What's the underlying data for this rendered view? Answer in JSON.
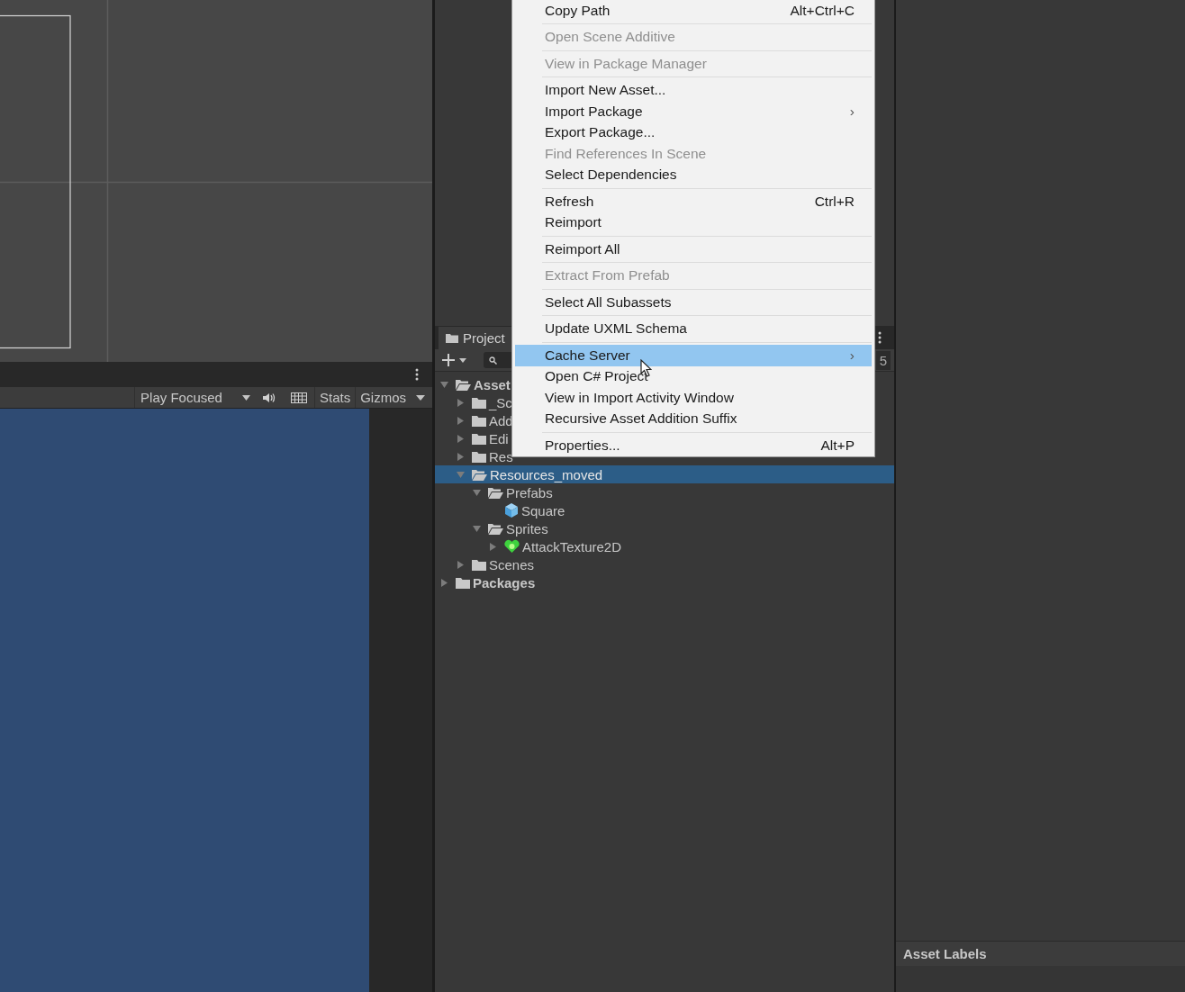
{
  "game_toolbar": {
    "play_mode": "Play Focused",
    "buttons": [
      {
        "label": "Stats"
      },
      {
        "label": "Gizmos"
      }
    ]
  },
  "project_panel": {
    "tab": "Project",
    "count": "5",
    "tree": [
      {
        "name": "Asset",
        "kind": "folder",
        "expanded": true,
        "selected": false,
        "children": [
          {
            "name": "_Sc",
            "kind": "folder",
            "expanded": false,
            "selected": false
          },
          {
            "name": "Add",
            "kind": "folder",
            "expanded": false,
            "selected": false
          },
          {
            "name": "Edi",
            "kind": "folder",
            "expanded": false,
            "selected": false
          },
          {
            "name": "Res",
            "kind": "folder",
            "expanded": false,
            "selected": false
          },
          {
            "name": "Resources_moved",
            "kind": "folder",
            "expanded": true,
            "selected": true,
            "children": [
              {
                "name": "Prefabs",
                "kind": "folder",
                "expanded": true,
                "selected": false,
                "children": [
                  {
                    "name": "Square",
                    "kind": "prefab",
                    "selected": false
                  }
                ]
              },
              {
                "name": "Sprites",
                "kind": "folder",
                "expanded": true,
                "selected": false,
                "children": [
                  {
                    "name": "AttackTexture2D",
                    "kind": "sprite",
                    "expanded": false,
                    "selected": false
                  }
                ]
              }
            ]
          },
          {
            "name": "Scenes",
            "kind": "folder",
            "expanded": false,
            "selected": false
          }
        ]
      },
      {
        "name": "Packages",
        "kind": "folder",
        "expanded": false,
        "selected": false
      }
    ]
  },
  "inspector": {
    "section": "Asset Labels"
  },
  "context_menu": {
    "groups": [
      [
        {
          "label": "Copy Path",
          "shortcut": "Alt+Ctrl+C",
          "disabled": false,
          "selected": false
        }
      ],
      [
        {
          "label": "Open Scene Additive",
          "disabled": true,
          "selected": false
        }
      ],
      [
        {
          "label": "View in Package Manager",
          "disabled": true,
          "selected": false
        }
      ],
      [
        {
          "label": "Import New Asset...",
          "disabled": false,
          "selected": false
        },
        {
          "label": "Import Package",
          "disabled": false,
          "selected": false,
          "arrow": "›"
        },
        {
          "label": "Export Package...",
          "disabled": false,
          "selected": false
        },
        {
          "label": "Find References In Scene",
          "disabled": true,
          "selected": false
        },
        {
          "label": "Select Dependencies",
          "disabled": false,
          "selected": false
        }
      ],
      [
        {
          "label": "Refresh",
          "shortcut": "Ctrl+R",
          "disabled": false,
          "selected": false
        },
        {
          "label": "Reimport",
          "disabled": false,
          "selected": false
        }
      ],
      [
        {
          "label": "Reimport All",
          "disabled": false,
          "selected": false
        }
      ],
      [
        {
          "label": "Extract From Prefab",
          "disabled": true,
          "selected": false
        }
      ],
      [
        {
          "label": "Select All Subassets",
          "disabled": false,
          "selected": false
        }
      ],
      [
        {
          "label": "Update UXML Schema",
          "disabled": false,
          "selected": false
        }
      ],
      [
        {
          "label": "Cache Server",
          "disabled": false,
          "selected": true,
          "arrow": "›"
        },
        {
          "label": "Open C# Project",
          "disabled": false,
          "selected": false
        },
        {
          "label": "View in Import Activity Window",
          "disabled": false,
          "selected": false
        },
        {
          "label": "Recursive Asset Addition Suffix",
          "disabled": false,
          "selected": false
        }
      ],
      [
        {
          "label": "Properties...",
          "shortcut": "Alt+P",
          "disabled": false,
          "selected": false
        }
      ]
    ]
  }
}
